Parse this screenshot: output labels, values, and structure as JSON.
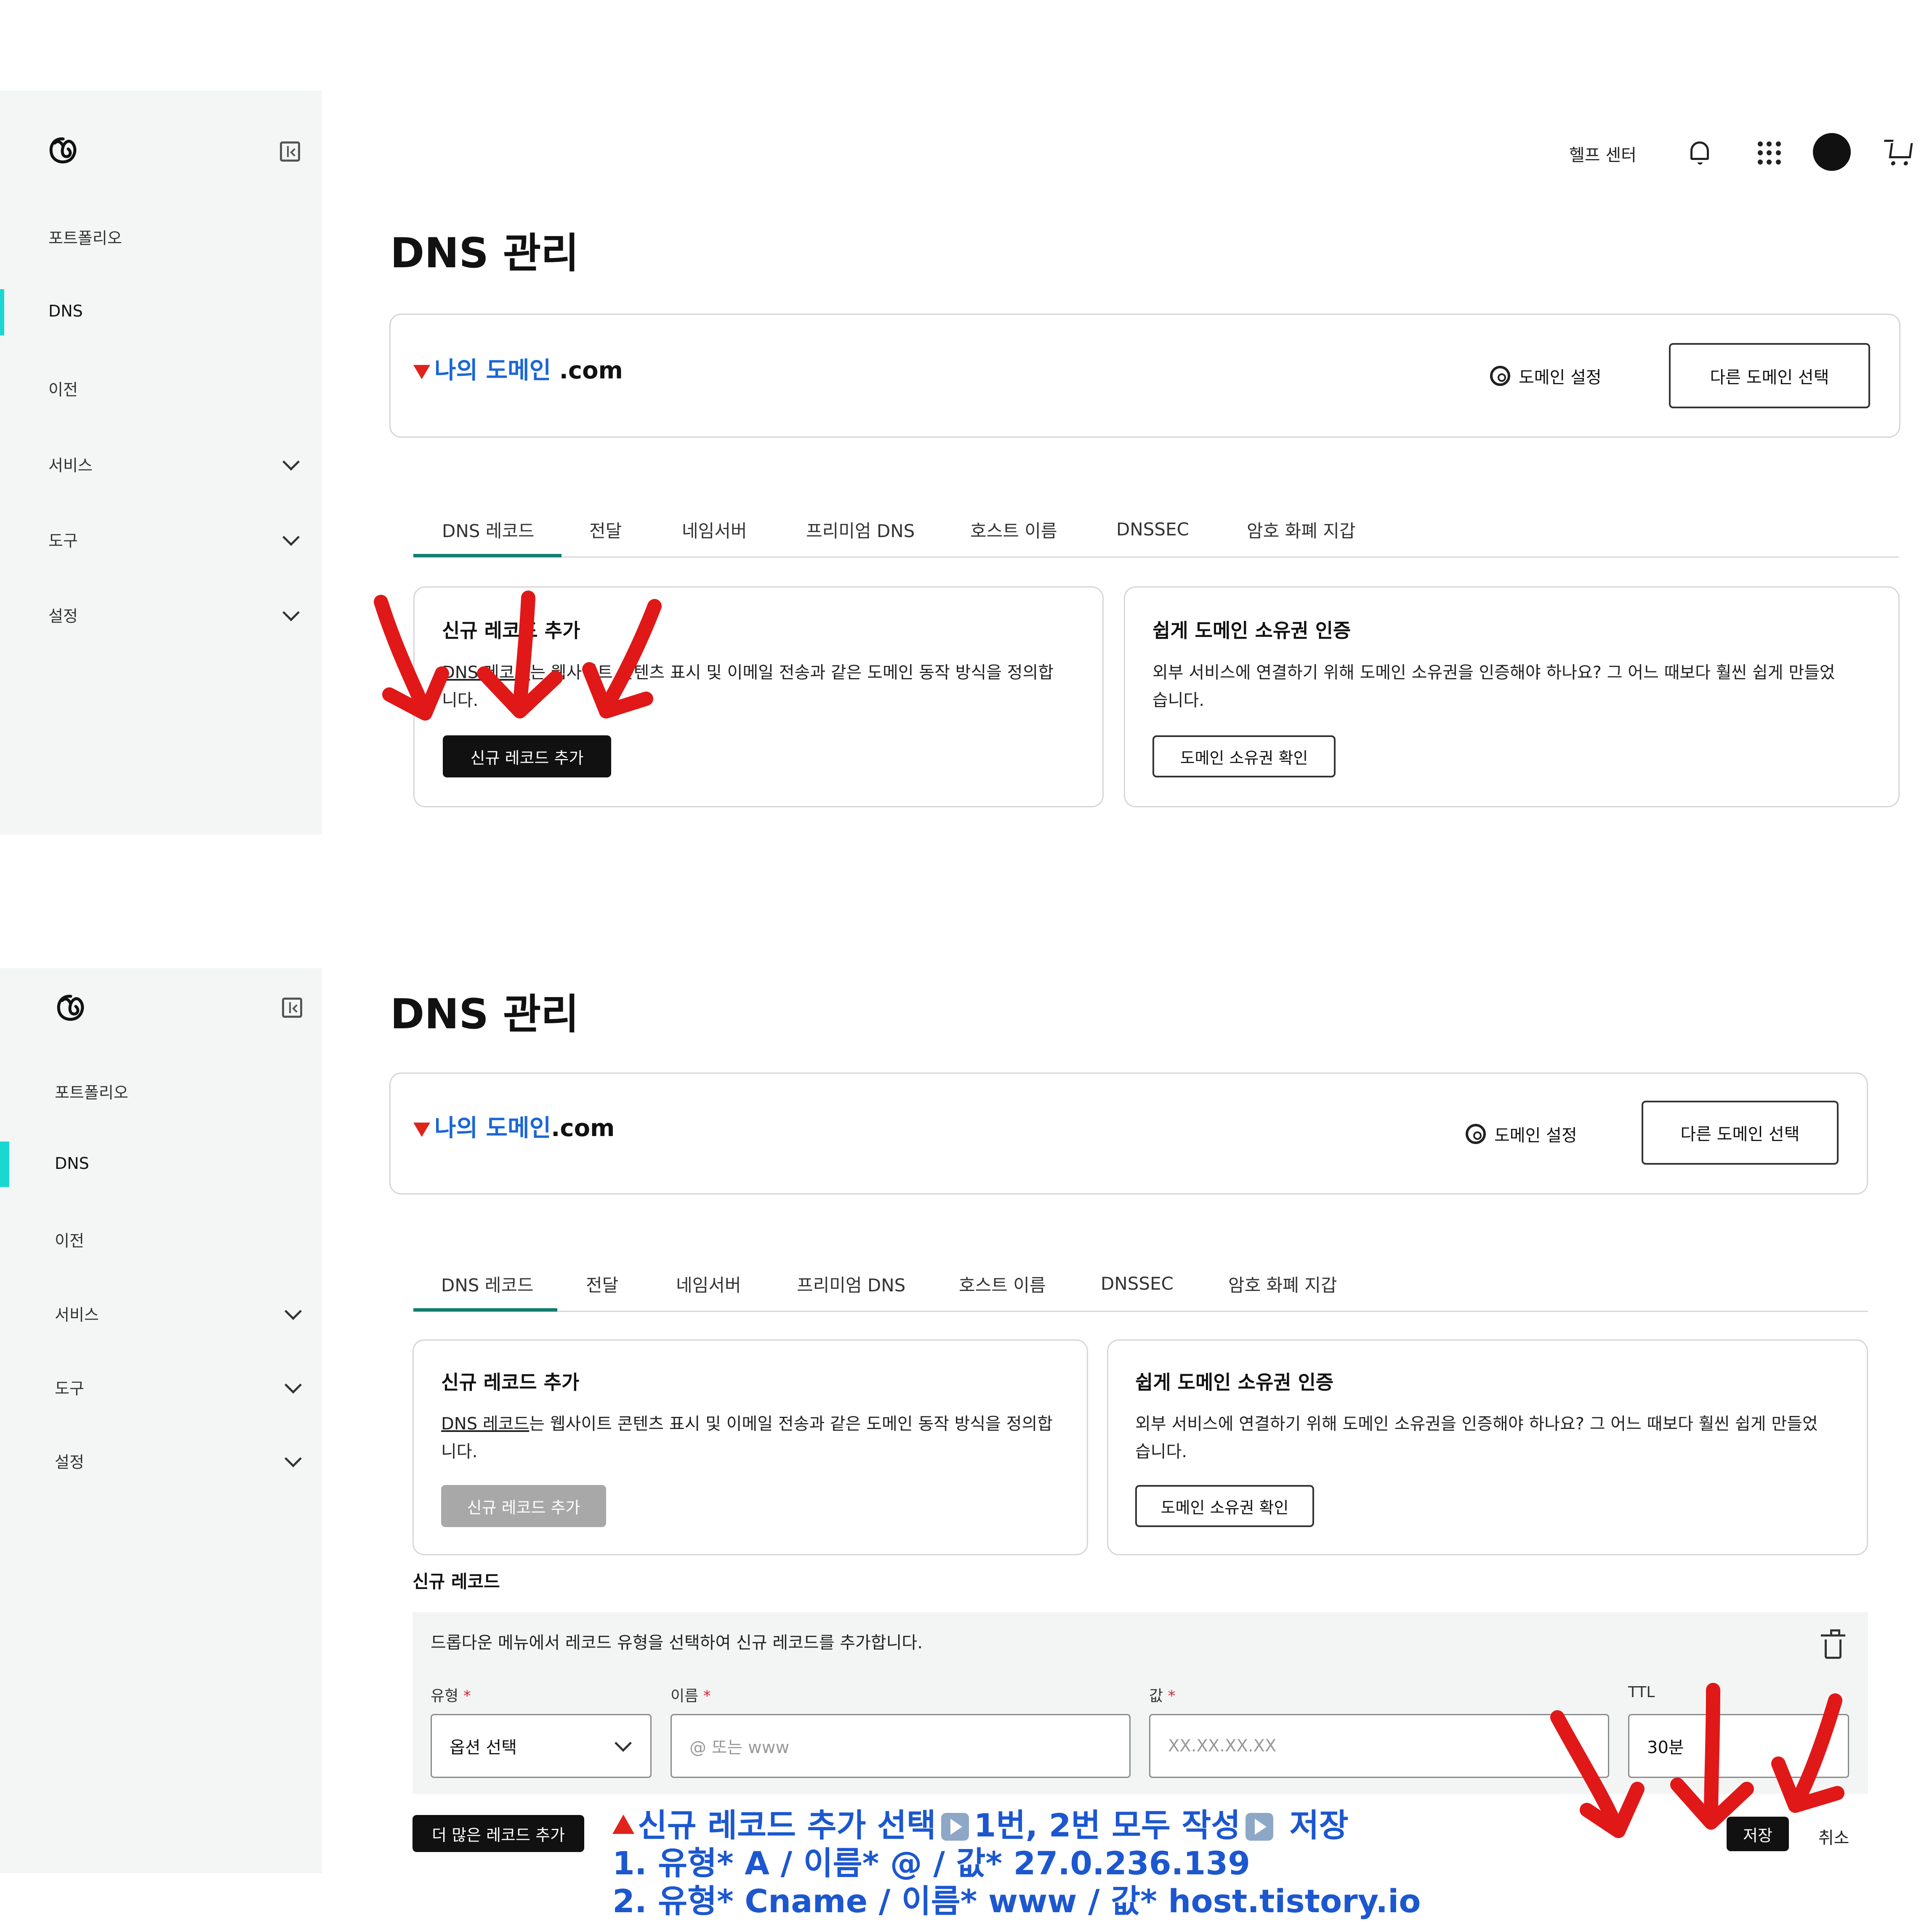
{
  "top": {
    "sidebar": {
      "items": [
        {
          "label": "포트폴리오"
        },
        {
          "label": "DNS"
        },
        {
          "label": "이전"
        },
        {
          "label": "서비스"
        },
        {
          "label": "도구"
        },
        {
          "label": "설정"
        }
      ]
    },
    "header": {
      "help": "헬프 센터"
    },
    "title": "DNS 관리",
    "domain": {
      "name": "나의 도메인",
      "tld": ".com",
      "settings": "도메인 설정",
      "other": "다른 도메인 선택"
    },
    "tabs": [
      "DNS 레코드",
      "전달",
      "네임서버",
      "프리미엄 DNS",
      "호스트 이름",
      "DNSSEC",
      "암호 화폐 지갑"
    ],
    "card_add": {
      "title": "신규 레코드 추가",
      "link": "DNS 레코드",
      "text_rest": "는 웹사이트 콘텐츠 표시 및 이메일 전송과 같은 도메인 동작 방식을 정의합",
      "text_line2": "니다.",
      "button": "신규 레코드 추가"
    },
    "card_verify": {
      "title": "쉽게 도메인 소유권 인증",
      "text_line1": "외부 서비스에 연결하기 위해 도메인 소유권을 인증해야 하나요? 그 어느 때보다 훨씬 쉽게 만들었",
      "text_line2": "습니다.",
      "button": "도메인 소유권 확인"
    }
  },
  "bottom": {
    "sidebar": {
      "items": [
        {
          "label": "포트폴리오"
        },
        {
          "label": "DNS"
        },
        {
          "label": "이전"
        },
        {
          "label": "서비스"
        },
        {
          "label": "도구"
        },
        {
          "label": "설정"
        }
      ]
    },
    "title": "DNS 관리",
    "domain": {
      "name": "나의 도메인",
      "tld": ".com",
      "settings": "도메인 설정",
      "other": "다른 도메인 선택"
    },
    "tabs": [
      "DNS 레코드",
      "전달",
      "네임서버",
      "프리미엄 DNS",
      "호스트 이름",
      "DNSSEC",
      "암호 화폐 지갑"
    ],
    "card_add": {
      "title": "신규 레코드 추가",
      "link": "DNS 레코드",
      "text_rest": "는 웹사이트 콘텐츠 표시 및 이메일 전송과 같은 도메인 동작 방식을 정의합",
      "text_line2": "니다.",
      "button": "신규 레코드 추가"
    },
    "card_verify": {
      "title": "쉽게 도메인 소유권 인증",
      "text_line1": "외부 서비스에 연결하기 위해 도메인 소유권을 인증해야 하나요? 그 어느 때보다 훨씬 쉽게 만들었",
      "text_line2": "습니다.",
      "button": "도메인 소유권 확인"
    },
    "new_record": {
      "heading": "신규 레코드",
      "description": "드롭다운 메뉴에서 레코드 유형을 선택하여 신규 레코드를 추가합니다.",
      "type_label": "유형",
      "name_label": "이름",
      "value_label": "값",
      "ttl_label": "TTL",
      "required_mark": "*",
      "type_value": "옵션 선택",
      "name_placeholder": "@ 또는 www",
      "value_placeholder": "XX.XX.XX.XX",
      "ttl_value": "30분",
      "more_button": "더 많은 레코드 추가",
      "save_button": "저장",
      "cancel_button": "취소"
    },
    "annotation": {
      "line1_a": "신규 레코드 추가 선택",
      "line1_b": "1번, 2번 모두 작성",
      "line1_c": "저장",
      "line2": "1. 유형* A / 이름* @ / 값* 27.0.236.139",
      "line3": "2. 유형* Cname / 이름* www / 값* host.tistory.io"
    }
  },
  "colors": {
    "accent": "#127e6f",
    "active_bar": "#1bd7d1",
    "annotation_blue": "#1c57cf",
    "arrow_red": "#e0231b",
    "domain_blue": "#1a66d6"
  }
}
